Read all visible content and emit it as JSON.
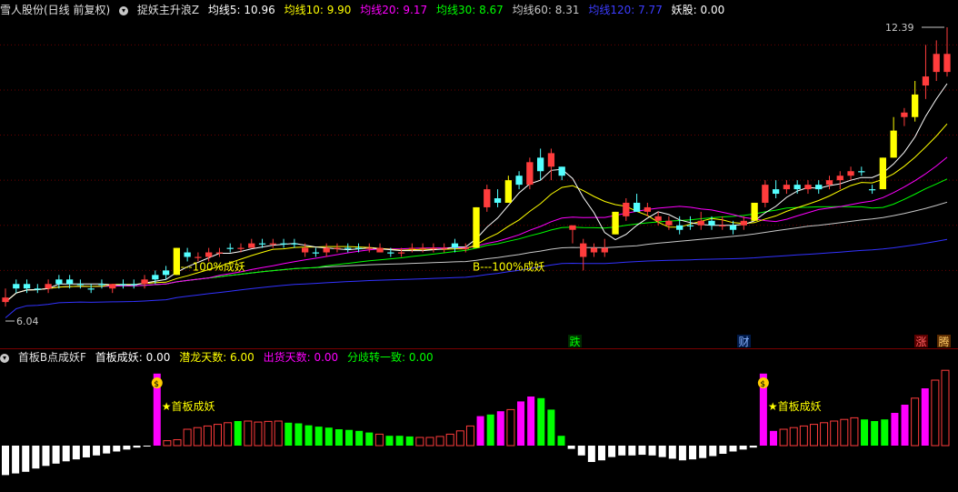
{
  "main_header": {
    "stock_name": "雪人股份(日线 前复权)",
    "indicator_name": "捉妖主升浪Z",
    "ma5": "均线5: 10.96",
    "ma10": "均线10: 9.90",
    "ma20": "均线20: 9.17",
    "ma30": "均线30: 8.67",
    "ma60": "均线60: 8.31",
    "ma120": "均线120: 7.77",
    "yaogu": "妖股: 0.00"
  },
  "sub_header": {
    "indicator_name": "首板B点成妖F",
    "shouban": "首板成妖: 0.00",
    "qianlong": "潜龙天数: 6.00",
    "chuhuo": "出货天数: 0.00",
    "fenqi": "分歧转一致: 0.00"
  },
  "main_annotations": {
    "max_price": "12.39",
    "min_price": "6.04",
    "signal1": "B---100%成妖",
    "signal2": "B---100%成妖",
    "tag_die": "跌",
    "tag_cai": "财",
    "tag_zhang": "涨",
    "tag_teng": "腾"
  },
  "sub_annotations": {
    "label1": "★首板成妖",
    "label2": "★首板成妖",
    "bag_icon_1": "money-bag-icon",
    "bag_icon_2": "money-bag-icon"
  },
  "colors": {
    "up": "#ff3c3c",
    "down": "#54ffff",
    "yellow": "#ffff00",
    "ma5": "#ffffff",
    "ma10": "#ffff00",
    "ma20": "#ff00ff",
    "ma30": "#00ff00",
    "ma60": "#c8c8c8",
    "ma120": "#3232ff",
    "magenta": "#ff00ff",
    "green": "#00ff00",
    "red": "#ff3c3c",
    "white": "#ffffff"
  },
  "chart_data": [
    {
      "type": "candlestick",
      "ylim": [
        6.04,
        12.39
      ],
      "gridlines": [
        12.0,
        11.0,
        10.0,
        9.0,
        8.0,
        7.0
      ],
      "ohlc": [
        [
          6.4,
          6.6,
          6.2,
          6.3,
          "up"
        ],
        [
          6.6,
          6.8,
          6.5,
          6.7,
          "down"
        ],
        [
          6.6,
          6.8,
          6.5,
          6.7,
          "down"
        ],
        [
          6.6,
          6.7,
          6.5,
          6.6,
          "down"
        ],
        [
          6.6,
          6.8,
          6.5,
          6.7,
          "up"
        ],
        [
          6.7,
          6.9,
          6.6,
          6.8,
          "down"
        ],
        [
          6.8,
          6.9,
          6.6,
          6.7,
          "down"
        ],
        [
          6.7,
          6.8,
          6.6,
          6.7,
          "down"
        ],
        [
          6.6,
          6.7,
          6.5,
          6.6,
          "down"
        ],
        [
          6.7,
          6.8,
          6.6,
          6.7,
          "down"
        ],
        [
          6.6,
          6.7,
          6.5,
          6.7,
          "up"
        ],
        [
          6.7,
          6.8,
          6.6,
          6.7,
          "down"
        ],
        [
          6.7,
          6.8,
          6.6,
          6.7,
          "down"
        ],
        [
          6.7,
          6.9,
          6.6,
          6.8,
          "up"
        ],
        [
          6.8,
          7.0,
          6.7,
          6.9,
          "down"
        ],
        [
          7.0,
          7.1,
          6.8,
          6.9,
          "down"
        ],
        [
          6.9,
          7.5,
          6.9,
          7.5,
          "yellow"
        ],
        [
          7.4,
          7.5,
          7.2,
          7.3,
          "down"
        ],
        [
          7.3,
          7.4,
          7.2,
          7.3,
          "up"
        ],
        [
          7.3,
          7.5,
          7.2,
          7.4,
          "up"
        ],
        [
          7.4,
          7.5,
          7.3,
          7.4,
          "up"
        ],
        [
          7.5,
          7.6,
          7.4,
          7.5,
          "down"
        ],
        [
          7.5,
          7.6,
          7.4,
          7.5,
          "up"
        ],
        [
          7.5,
          7.7,
          7.5,
          7.6,
          "up"
        ],
        [
          7.6,
          7.7,
          7.5,
          7.6,
          "down"
        ],
        [
          7.6,
          7.7,
          7.5,
          7.6,
          "up"
        ],
        [
          7.6,
          7.7,
          7.5,
          7.6,
          "down"
        ],
        [
          7.6,
          7.7,
          7.5,
          7.6,
          "down"
        ],
        [
          7.5,
          7.6,
          7.3,
          7.4,
          "up"
        ],
        [
          7.4,
          7.5,
          7.3,
          7.4,
          "down"
        ],
        [
          7.4,
          7.6,
          7.3,
          7.5,
          "up"
        ],
        [
          7.5,
          7.6,
          7.4,
          7.5,
          "up"
        ],
        [
          7.5,
          7.6,
          7.4,
          7.5,
          "down"
        ],
        [
          7.5,
          7.6,
          7.4,
          7.5,
          "down"
        ],
        [
          7.5,
          7.6,
          7.4,
          7.5,
          "up"
        ],
        [
          7.5,
          7.6,
          7.4,
          7.4,
          "up"
        ],
        [
          7.4,
          7.5,
          7.3,
          7.4,
          "down"
        ],
        [
          7.4,
          7.5,
          7.3,
          7.4,
          "up"
        ],
        [
          7.5,
          7.6,
          7.4,
          7.5,
          "up"
        ],
        [
          7.5,
          7.6,
          7.4,
          7.5,
          "up"
        ],
        [
          7.5,
          7.6,
          7.4,
          7.5,
          "up"
        ],
        [
          7.5,
          7.6,
          7.4,
          7.5,
          "up"
        ],
        [
          7.5,
          7.7,
          7.4,
          7.6,
          "down"
        ],
        [
          7.5,
          7.6,
          7.4,
          7.5,
          "up"
        ],
        [
          7.5,
          8.4,
          7.5,
          8.4,
          "yellow"
        ],
        [
          8.4,
          8.9,
          8.3,
          8.8,
          "up"
        ],
        [
          8.6,
          8.8,
          8.4,
          8.5,
          "down"
        ],
        [
          8.5,
          9.1,
          8.5,
          9.0,
          "yellow"
        ],
        [
          9.1,
          9.2,
          8.8,
          8.9,
          "down"
        ],
        [
          8.9,
          9.5,
          8.8,
          9.4,
          "up"
        ],
        [
          9.5,
          9.7,
          9.0,
          9.2,
          "down"
        ],
        [
          9.3,
          9.7,
          9.0,
          9.6,
          "up"
        ],
        [
          9.3,
          9.3,
          9.0,
          9.1,
          "down"
        ],
        [
          8.0,
          8.0,
          7.6,
          7.9,
          "up"
        ],
        [
          7.6,
          7.7,
          7.0,
          7.3,
          "up"
        ],
        [
          7.4,
          7.6,
          7.3,
          7.5,
          "up"
        ],
        [
          7.5,
          7.7,
          7.3,
          7.4,
          "up"
        ],
        [
          7.8,
          8.3,
          7.8,
          8.3,
          "yellow"
        ],
        [
          8.2,
          8.6,
          8.1,
          8.5,
          "up"
        ],
        [
          8.5,
          8.7,
          8.3,
          8.3,
          "down"
        ],
        [
          8.4,
          8.5,
          8.2,
          8.3,
          "up"
        ],
        [
          8.2,
          8.3,
          8.0,
          8.1,
          "up"
        ],
        [
          8.1,
          8.2,
          7.9,
          8.0,
          "up"
        ],
        [
          8.0,
          8.2,
          7.8,
          7.9,
          "down"
        ],
        [
          8.0,
          8.2,
          7.9,
          8.0,
          "down"
        ],
        [
          8.0,
          8.3,
          7.9,
          8.1,
          "up"
        ],
        [
          8.1,
          8.2,
          7.9,
          8.0,
          "down"
        ],
        [
          8.0,
          8.2,
          7.9,
          8.0,
          "up"
        ],
        [
          8.0,
          8.1,
          7.8,
          7.9,
          "down"
        ],
        [
          8.0,
          8.2,
          7.9,
          8.1,
          "up"
        ],
        [
          8.1,
          8.5,
          8.1,
          8.5,
          "yellow"
        ],
        [
          8.5,
          9.0,
          8.4,
          8.9,
          "up"
        ],
        [
          8.8,
          9.0,
          8.6,
          8.7,
          "down"
        ],
        [
          8.8,
          9.0,
          8.7,
          8.9,
          "up"
        ],
        [
          8.9,
          9.0,
          8.7,
          8.8,
          "down"
        ],
        [
          8.8,
          9.0,
          8.7,
          8.9,
          "up"
        ],
        [
          8.9,
          9.0,
          8.7,
          8.8,
          "down"
        ],
        [
          8.9,
          9.1,
          8.8,
          9.0,
          "up"
        ],
        [
          9.0,
          9.2,
          8.8,
          9.1,
          "up"
        ],
        [
          9.1,
          9.3,
          9.0,
          9.2,
          "up"
        ],
        [
          9.2,
          9.3,
          9.1,
          9.2,
          "down"
        ],
        [
          8.8,
          8.9,
          8.7,
          8.8,
          "down"
        ],
        [
          8.8,
          9.5,
          8.8,
          9.5,
          "yellow"
        ],
        [
          9.5,
          10.4,
          9.5,
          10.1,
          "yellow"
        ],
        [
          10.4,
          10.6,
          10.2,
          10.5,
          "up"
        ],
        [
          10.4,
          11.2,
          10.3,
          10.9,
          "yellow"
        ],
        [
          11.3,
          12.0,
          10.8,
          11.1,
          "up"
        ],
        [
          11.8,
          12.1,
          11.2,
          11.4,
          "up"
        ],
        [
          11.4,
          12.39,
          11.3,
          11.8,
          "up"
        ]
      ],
      "signals": [
        "B---100%成妖",
        "B---100%成妖"
      ],
      "price_labels": [
        "12.39",
        "6.04"
      ]
    },
    {
      "type": "bar",
      "series_values": [
        [
          -0.9,
          "white"
        ],
        [
          -0.85,
          "white"
        ],
        [
          -0.8,
          "white"
        ],
        [
          -0.7,
          "white"
        ],
        [
          -0.62,
          "white"
        ],
        [
          -0.55,
          "white"
        ],
        [
          -0.48,
          "white"
        ],
        [
          -0.42,
          "white"
        ],
        [
          -0.36,
          "white"
        ],
        [
          -0.3,
          "white"
        ],
        [
          -0.24,
          "white"
        ],
        [
          -0.18,
          "white"
        ],
        [
          -0.12,
          "white"
        ],
        [
          -0.06,
          "white"
        ],
        [
          0.0,
          "white"
        ],
        [
          2.2,
          "magenta"
        ],
        [
          0.15,
          "red"
        ],
        [
          0.18,
          "red"
        ],
        [
          0.5,
          "red"
        ],
        [
          0.55,
          "red"
        ],
        [
          0.6,
          "red"
        ],
        [
          0.65,
          "red"
        ],
        [
          0.7,
          "red"
        ],
        [
          0.75,
          "green"
        ],
        [
          0.75,
          "red"
        ],
        [
          0.72,
          "red"
        ],
        [
          0.74,
          "red"
        ],
        [
          0.75,
          "red"
        ],
        [
          0.7,
          "green"
        ],
        [
          0.68,
          "green"
        ],
        [
          0.62,
          "green"
        ],
        [
          0.58,
          "green"
        ],
        [
          0.55,
          "green"
        ],
        [
          0.5,
          "green"
        ],
        [
          0.48,
          "green"
        ],
        [
          0.45,
          "green"
        ],
        [
          0.4,
          "green"
        ],
        [
          0.35,
          "red"
        ],
        [
          0.3,
          "green"
        ],
        [
          0.3,
          "green"
        ],
        [
          0.28,
          "green"
        ],
        [
          0.25,
          "red"
        ],
        [
          0.25,
          "red"
        ],
        [
          0.28,
          "red"
        ],
        [
          0.35,
          "red"
        ],
        [
          0.45,
          "red"
        ],
        [
          0.6,
          "red"
        ],
        [
          0.9,
          "magenta"
        ],
        [
          0.95,
          "green"
        ],
        [
          1.05,
          "magenta"
        ],
        [
          1.1,
          "red"
        ],
        [
          1.35,
          "magenta"
        ],
        [
          1.5,
          "magenta"
        ],
        [
          1.45,
          "green"
        ],
        [
          1.1,
          "green"
        ],
        [
          0.3,
          "green"
        ],
        [
          -0.1,
          "white"
        ],
        [
          -0.3,
          "white"
        ],
        [
          -0.5,
          "white"
        ],
        [
          -0.45,
          "white"
        ],
        [
          -0.35,
          "white"
        ],
        [
          -0.3,
          "white"
        ],
        [
          -0.3,
          "white"
        ],
        [
          -0.28,
          "white"
        ],
        [
          -0.3,
          "white"
        ],
        [
          -0.35,
          "white"
        ],
        [
          -0.4,
          "white"
        ],
        [
          -0.45,
          "white"
        ],
        [
          -0.42,
          "white"
        ],
        [
          -0.38,
          "white"
        ],
        [
          -0.32,
          "white"
        ],
        [
          -0.25,
          "white"
        ],
        [
          -0.18,
          "white"
        ],
        [
          -0.12,
          "white"
        ],
        [
          -0.06,
          "white"
        ],
        [
          2.2,
          "magenta"
        ],
        [
          0.45,
          "magenta"
        ],
        [
          0.5,
          "red"
        ],
        [
          0.55,
          "red"
        ],
        [
          0.6,
          "red"
        ],
        [
          0.65,
          "red"
        ],
        [
          0.7,
          "red"
        ],
        [
          0.75,
          "red"
        ],
        [
          0.8,
          "red"
        ],
        [
          0.85,
          "red"
        ],
        [
          0.8,
          "green"
        ],
        [
          0.75,
          "green"
        ],
        [
          0.8,
          "green"
        ],
        [
          1.0,
          "magenta"
        ],
        [
          1.25,
          "magenta"
        ],
        [
          1.45,
          "red"
        ],
        [
          1.75,
          "magenta"
        ],
        [
          2.0,
          "red"
        ],
        [
          2.3,
          "red"
        ]
      ]
    }
  ]
}
